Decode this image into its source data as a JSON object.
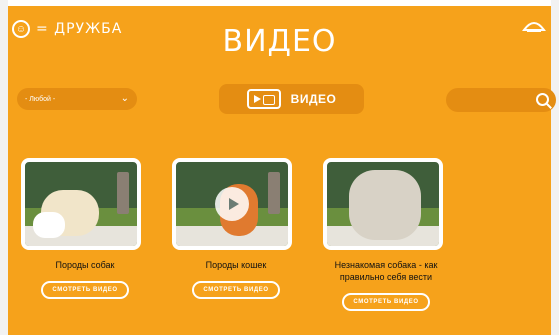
{
  "brand": {
    "name": "= ДРУЖБА"
  },
  "header": {
    "title": "ВИДЕО"
  },
  "filters": {
    "selected": "- Любой -"
  },
  "section": {
    "label": "ВИДЕО"
  },
  "search": {
    "placeholder": ""
  },
  "videos": [
    {
      "title": "Породы собак",
      "button": "СМОТРЕТЬ ВИДЕО"
    },
    {
      "title": "Породы кошек",
      "button": "СМОТРЕТЬ ВИДЕО"
    },
    {
      "title": "Незнакомая собака - как правильно себя вести",
      "button": "СМОТРЕТЬ ВИДЕО"
    }
  ],
  "colors": {
    "background": "#f6a21b",
    "control": "#e48d12",
    "text_light": "#ffffff",
    "text_dark": "#111111"
  }
}
